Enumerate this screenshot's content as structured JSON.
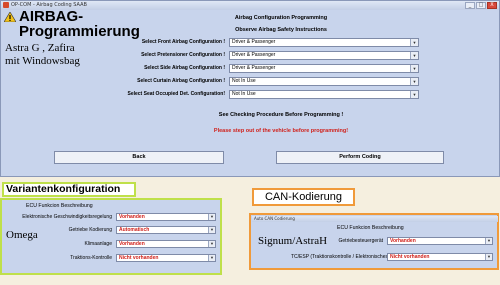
{
  "window": {
    "title": "OP-COM - Airbag Coding SAAB",
    "btn_min": "_",
    "btn_max": "□",
    "btn_close": "X"
  },
  "overlay": {
    "title_line1": "AIRBAG-",
    "title_line2": "Programmierung",
    "subtitle_line1": "Astra G , Zafira",
    "subtitle_line2": "mit Windowsbag"
  },
  "main": {
    "heading": "Airbag Configuration Programming",
    "instructions": "Observe Airbag Safety Instructions",
    "fields": [
      {
        "label": "Select Front Airbag Configuration !",
        "value": "Driver & Passenger"
      },
      {
        "label": "Select Pretensioner Configuration !",
        "value": "Driver & Passenger"
      },
      {
        "label": "Select Side Airbag Configuration !",
        "value": "Driver & Passenger"
      },
      {
        "label": "Select Curtain Airbag Configuration !",
        "value": "Not In Use"
      },
      {
        "label": "Select Seat Occupied Det. Configuration!",
        "value": "Not In Use"
      }
    ],
    "checking_text": "See Checking Procedure Before Programming !",
    "warning_text": "Please step out of the vehicle before programming!",
    "back_label": "Back",
    "perform_label": "Perform Coding"
  },
  "variant": {
    "section_label": "Variantenkonfiguration",
    "column_header": "ECU Funkcion Beschreibung",
    "overlay_label": "Omega",
    "rows": [
      {
        "label": "Elektronische Geschwindigkeitsregelung",
        "value": "Vorhanden"
      },
      {
        "label": "Getriebe Kodierung",
        "value": "Automatisch"
      },
      {
        "label": "Klimaanlage",
        "value": "Vorhanden"
      },
      {
        "label": "Traktions-Kontrolle",
        "value": "Nicht vorhanden"
      }
    ]
  },
  "can": {
    "section_label": "CAN-Kodierung",
    "window_title": "Auto CAN Codierung",
    "column_header": "ECU Funkcion Beschreibung",
    "overlay_label": "Signum/AstraH",
    "rows": [
      {
        "label": "Getriebesteuergerät",
        "value": "Vorhanden"
      },
      {
        "label": "TC/ESP (Traktionskontrolle / Elektronisches Stabilitäts Program)",
        "value": "Nicht vorhanden"
      }
    ]
  },
  "colors": {
    "panel_bg": "#c8d4ec",
    "warning_red": "#d0201a",
    "variant_border": "#bfe04a",
    "can_border": "#f09a3a"
  }
}
